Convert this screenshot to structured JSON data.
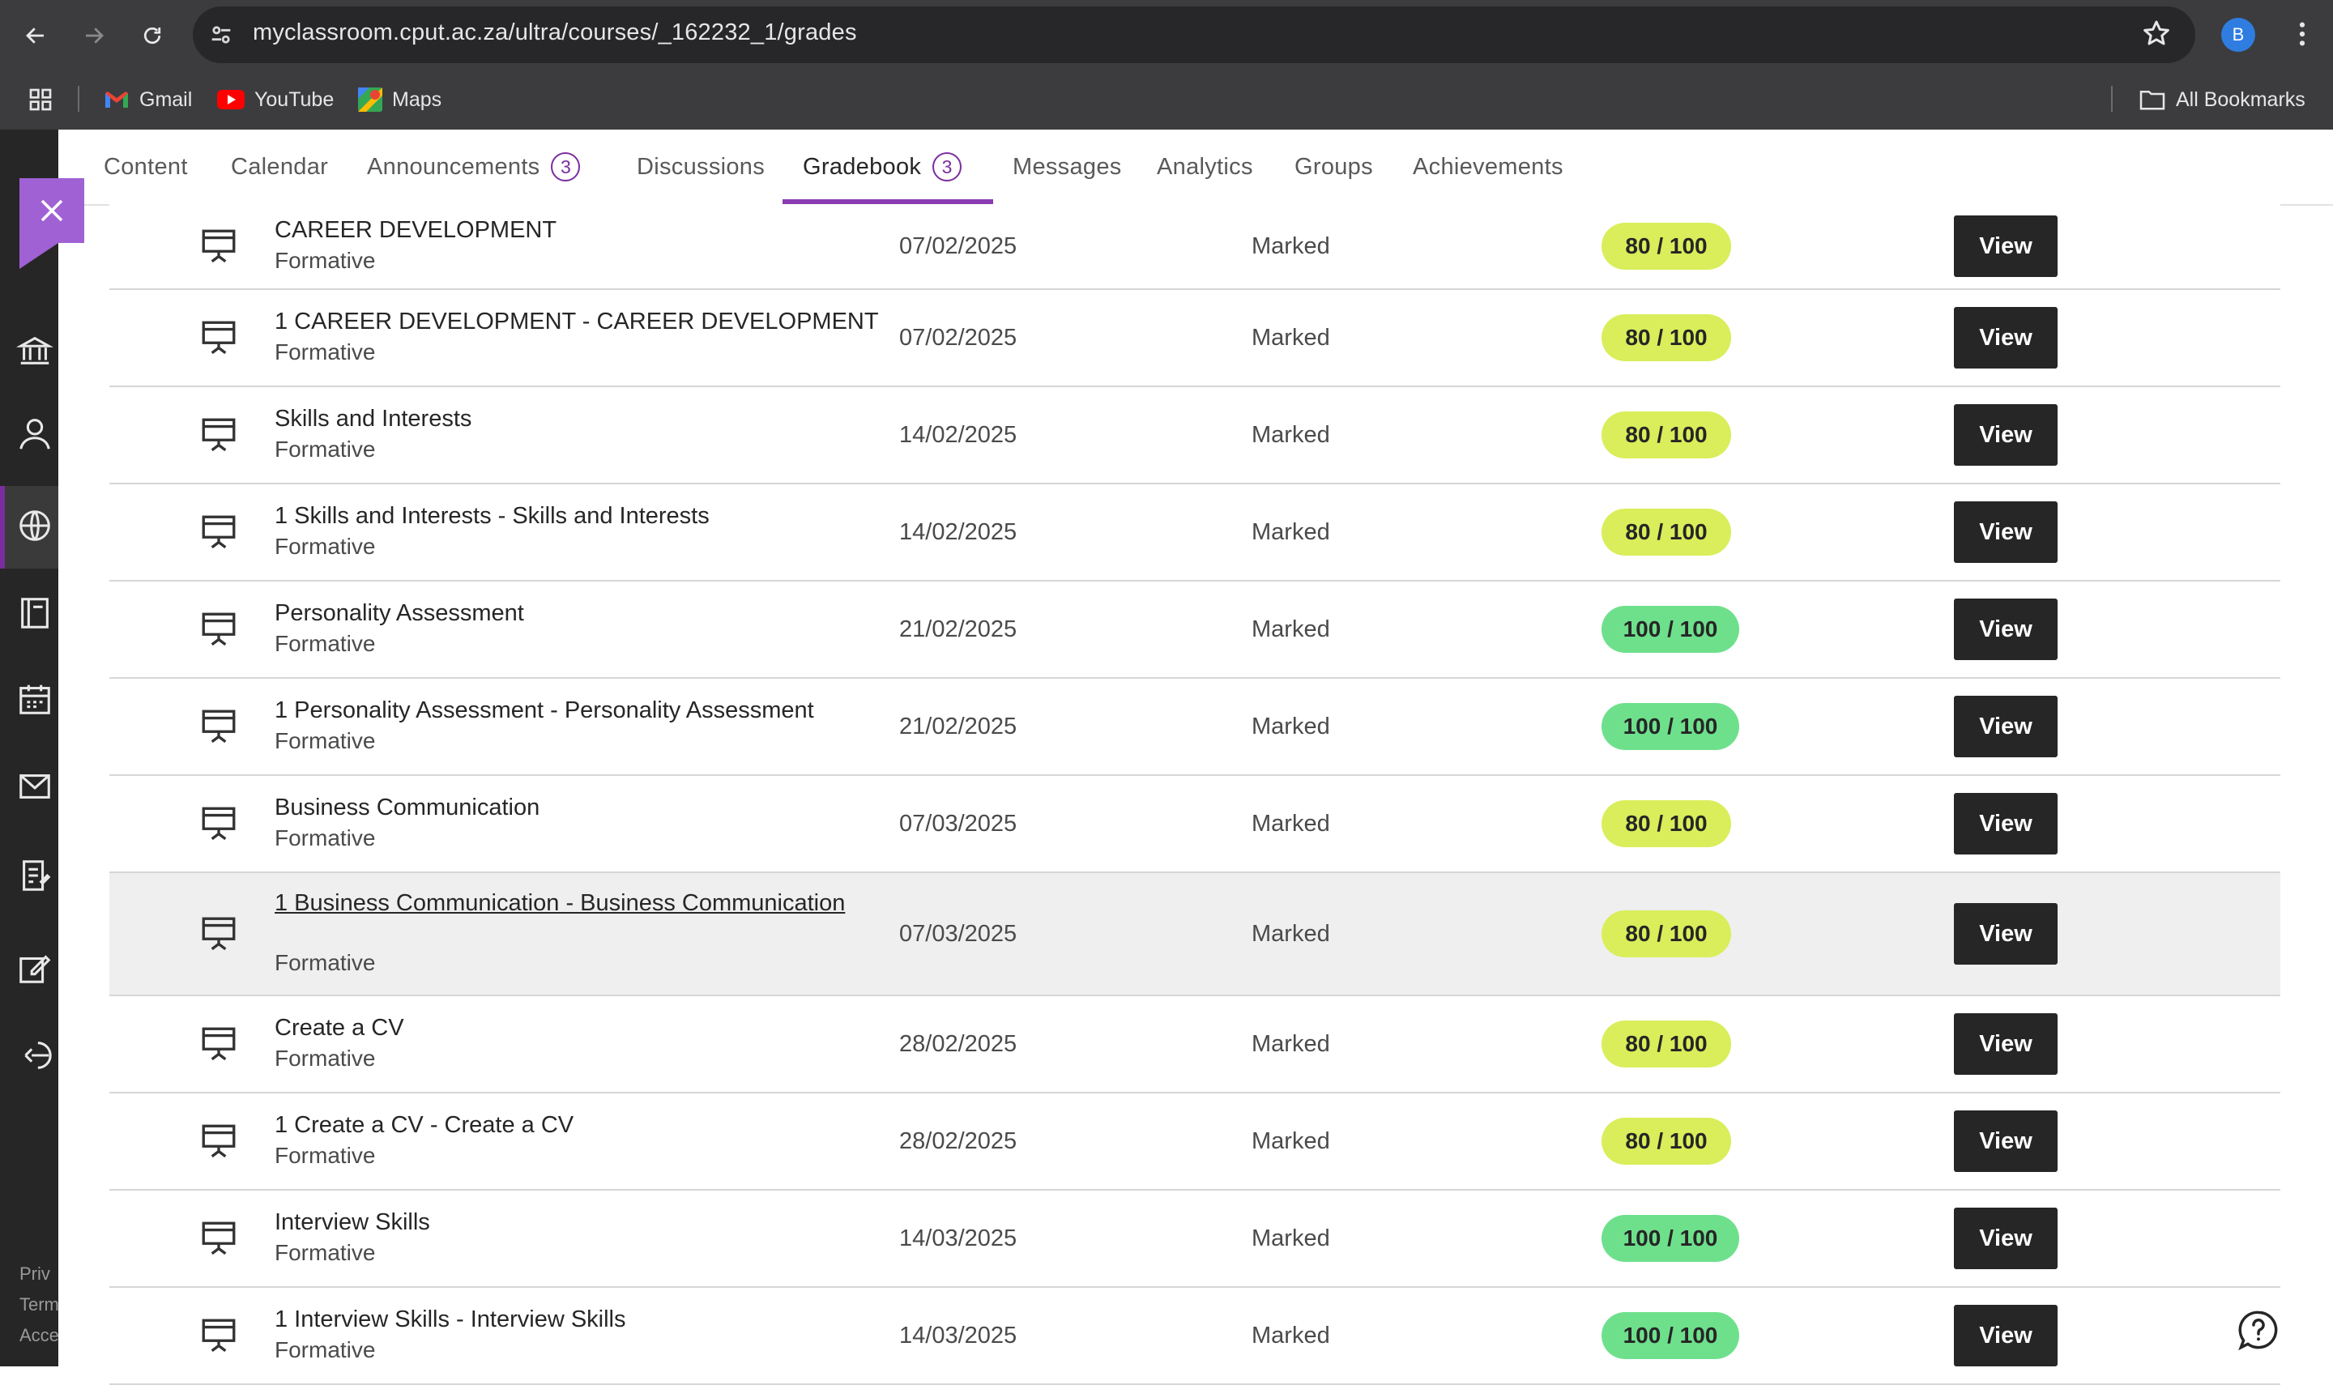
{
  "browser": {
    "url": "myclassroom.cput.ac.za/ultra/courses/_162232_1/grades",
    "profile_initial": "B",
    "bookmarks": [
      {
        "label": "Gmail",
        "icon": "gmail-icon"
      },
      {
        "label": "YouTube",
        "icon": "youtube-icon"
      },
      {
        "label": "Maps",
        "icon": "maps-icon"
      }
    ],
    "all_bookmarks_label": "All Bookmarks"
  },
  "colors": {
    "accent": "#7b2d9f",
    "pill_yellow": "#d9ee5a",
    "pill_green": "#6ee08c",
    "button_dark": "#262626"
  },
  "tabs": [
    {
      "label": "Content"
    },
    {
      "label": "Calendar"
    },
    {
      "label": "Announcements",
      "count": "3"
    },
    {
      "label": "Discussions"
    },
    {
      "label": "Gradebook",
      "count": "3",
      "active": true
    },
    {
      "label": "Messages"
    },
    {
      "label": "Analytics"
    },
    {
      "label": "Groups"
    },
    {
      "label": "Achievements"
    }
  ],
  "rail_footer": [
    "Priv",
    "Term",
    "Acce"
  ],
  "grades": [
    {
      "title": "CAREER DEVELOPMENT",
      "category": "Formative",
      "date": "07/02/2025",
      "status": "Marked",
      "grade": "80 / 100",
      "grade_color": "yellow",
      "action": "View"
    },
    {
      "title": "1 CAREER DEVELOPMENT - CAREER DEVELOPMENT",
      "category": "Formative",
      "date": "07/02/2025",
      "status": "Marked",
      "grade": "80 / 100",
      "grade_color": "yellow",
      "action": "View"
    },
    {
      "title": "Skills and Interests",
      "category": "Formative",
      "date": "14/02/2025",
      "status": "Marked",
      "grade": "80 / 100",
      "grade_color": "yellow",
      "action": "View"
    },
    {
      "title": "1 Skills and Interests - Skills and Interests",
      "category": "Formative",
      "date": "14/02/2025",
      "status": "Marked",
      "grade": "80 / 100",
      "grade_color": "yellow",
      "action": "View"
    },
    {
      "title": "Personality Assessment",
      "category": "Formative",
      "date": "21/02/2025",
      "status": "Marked",
      "grade": "100 / 100",
      "grade_color": "green",
      "action": "View"
    },
    {
      "title": "1 Personality Assessment - Personality Assessment",
      "category": "Formative",
      "date": "21/02/2025",
      "status": "Marked",
      "grade": "100 / 100",
      "grade_color": "green",
      "action": "View"
    },
    {
      "title": "Business Communication",
      "category": "Formative",
      "date": "07/03/2025",
      "status": "Marked",
      "grade": "80 / 100",
      "grade_color": "yellow",
      "action": "View"
    },
    {
      "title": "1 Business Communication - Business Communication",
      "category": "Formative",
      "date": "07/03/2025",
      "status": "Marked",
      "grade": "80 / 100",
      "grade_color": "yellow",
      "action": "View",
      "highlighted": true
    },
    {
      "title": "Create a CV",
      "category": "Formative",
      "date": "28/02/2025",
      "status": "Marked",
      "grade": "80 / 100",
      "grade_color": "yellow",
      "action": "View"
    },
    {
      "title": "1 Create a CV - Create a CV",
      "category": "Formative",
      "date": "28/02/2025",
      "status": "Marked",
      "grade": "80 / 100",
      "grade_color": "yellow",
      "action": "View"
    },
    {
      "title": "Interview Skills",
      "category": "Formative",
      "date": "14/03/2025",
      "status": "Marked",
      "grade": "100 / 100",
      "grade_color": "green",
      "action": "View"
    },
    {
      "title": "1 Interview Skills - Interview Skills",
      "category": "Formative",
      "date": "14/03/2025",
      "status": "Marked",
      "grade": "100 / 100",
      "grade_color": "green",
      "action": "View"
    }
  ]
}
